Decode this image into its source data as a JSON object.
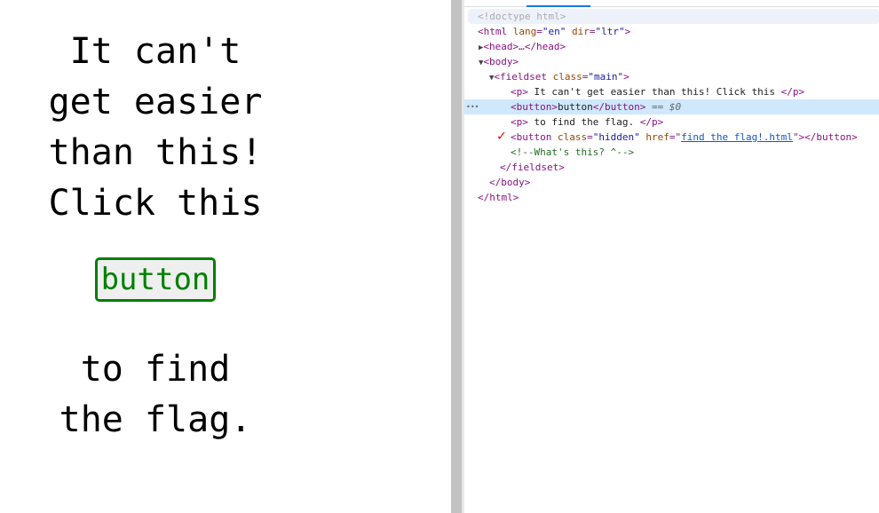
{
  "page": {
    "text_before": [
      "It can't",
      "get easier",
      "than this!",
      "Click this"
    ],
    "button_label": "button",
    "text_after": [
      "to find",
      "the flag."
    ],
    "accent": "#008000"
  },
  "devtools": {
    "doctype": "<!doctype html>",
    "html_open": "<html",
    "html_lang_attr": "lang",
    "html_lang_val": "\"en\"",
    "html_dir_attr": "dir",
    "html_dir_val": "\"ltr\"",
    "head": "<head>…</head>",
    "body_open": "<body>",
    "fieldset_open": "<fieldset",
    "fieldset_attr": "class",
    "fieldset_val": "\"main\"",
    "p1_text": " It can't get easier than this! Click this ",
    "button_text": "button",
    "selected_marker": "== $0",
    "p2_text": " to find the flag. ",
    "hidden_button_class": "\"hidden\"",
    "hidden_button_href": "find the flag!.html",
    "comment": "<!--What's this? ^-->",
    "fieldset_close": "</fieldset>",
    "body_close": "</body>",
    "html_close": "</html>",
    "ellipsis": "•••",
    "check": "✓"
  }
}
